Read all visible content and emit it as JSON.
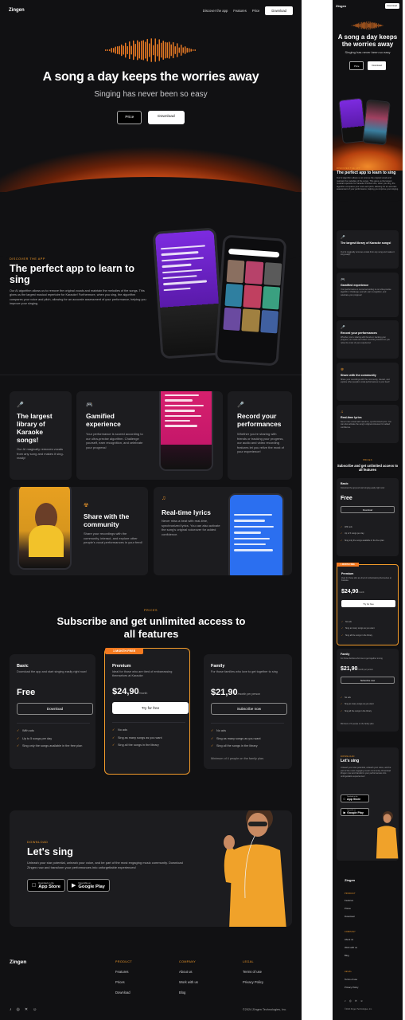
{
  "brand": "Zingen",
  "nav": {
    "links": [
      "Discover the app",
      "Features",
      "Price"
    ],
    "download": "Download"
  },
  "hero": {
    "title": "A song a day keeps the worries away",
    "subtitle": "Singing has never been so easy",
    "price_btn": "Price",
    "download_btn": "Download"
  },
  "app": {
    "kicker": "DISCOVER THE APP",
    "title": "The perfect app to learn to sing",
    "text": "Our AI algorithm allows us to remove the original vocals and maintain the melodies of the songs. This gives us the largest musical repertoire for Karaoke! Furthermore, when you sing, the algorithm compares your voice and pitch, allowing for an accurate assessment of your performance, helping you improve your singing."
  },
  "features": [
    {
      "icon": "mic-icon",
      "glyph": "🎤",
      "title": "The largest library of Karaoke songs!",
      "text": "Our AI magically removes vocals from any song and makes it sing-ready!"
    },
    {
      "icon": "gamepad-icon",
      "glyph": "🎮",
      "title": "Gamified experience",
      "text": "Your performance is scored according to our ultra-precise algorithm. Challenge yourself, earn recognition, and celebrate your progress!"
    },
    {
      "icon": "microphone-icon",
      "glyph": "🎤",
      "title": "Record your performances",
      "text": "Whether you're sharing with friends or tracking your progress, our audio and video recording features let you relive the most of your experience!"
    },
    {
      "icon": "community-icon",
      "glyph": "☢",
      "title": "Share with the community",
      "text": "Share your recordings with the community, interact, and explore other people's vocal performances in your feed!"
    },
    {
      "icon": "music-note-icon",
      "glyph": "♫",
      "title": "Real-time lyrics",
      "text": "Never miss a beat with real-time, synchronized lyrics. You can also activate the song's original voiceover for added confidence."
    }
  ],
  "pricing": {
    "kicker": "PRICES",
    "title": "Subscribe and get unlimited access to all features",
    "badge": "1 MONTH FREE",
    "plans": [
      {
        "name": "Basic",
        "desc": "Download the app and start singing easily right now!",
        "price": "Free",
        "per": "",
        "cta": "Download",
        "features": [
          "With ads",
          "Up to 5 songs per day",
          "Sing only the songs available in the free plan"
        ],
        "note": ""
      },
      {
        "name": "Premium",
        "desc": "Ideal for those who are tired of embarrassing themselves at Karaoke",
        "price": "$24,90",
        "per": "/month",
        "cta": "Try for free",
        "features": [
          "No ads",
          "Sing as many songs as you want",
          "Sing all the songs in the library"
        ],
        "note": ""
      },
      {
        "name": "Family",
        "desc": "For those families who love to get together to sing",
        "price": "$21,90",
        "per": "/month per person",
        "cta": "Subscribe now",
        "features": [
          "No ads",
          "Sing as many songs as you want",
          "Sing all the songs in the library"
        ],
        "note": "Minimum of 4 people on the family plan."
      }
    ]
  },
  "download": {
    "kicker": "DOWNLOAD",
    "title": "Let's sing",
    "text": "Unleash your star potential, unleash your voice, and be part of the most engaging music community. Download Zingen now and transform your performances into unforgettable experiences!",
    "appstore_small": "Download on the",
    "appstore": "App Store",
    "gplay_small": "Disponible en",
    "gplay": "Google Play"
  },
  "footer": {
    "cols": [
      {
        "head": "PRODUCT",
        "links": [
          "Features",
          "Prices",
          "Download"
        ]
      },
      {
        "head": "COMPANY",
        "links": [
          "About us",
          "Work with us",
          "Blog"
        ]
      },
      {
        "head": "LEGAL",
        "links": [
          "Terms of use",
          "Privacy Policy"
        ]
      }
    ],
    "socials": [
      "tiktok-icon",
      "instagram-icon",
      "x-icon",
      "discord-icon"
    ],
    "copyright": "©2024 Zingen Technologies, Inc."
  },
  "colors": {
    "accent": "#f39b2a",
    "bg": "#111113",
    "card": "#1c1c1f"
  }
}
